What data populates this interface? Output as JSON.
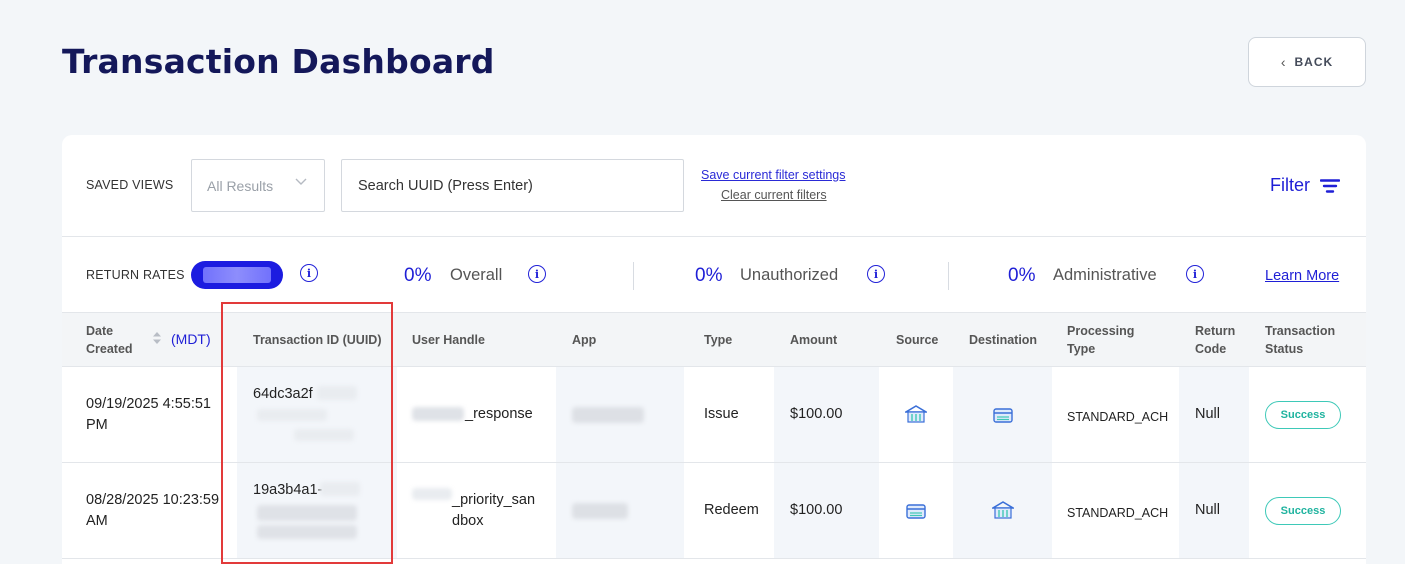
{
  "page": {
    "title": "Transaction Dashboard",
    "back_label": "BACK"
  },
  "filters": {
    "saved_views_label": "SAVED VIEWS",
    "saved_views_value": "All Results",
    "search_placeholder": "Search UUID (Press Enter)",
    "save_link": "Save current filter settings",
    "clear_link": "Clear current filters",
    "filter_label": "Filter"
  },
  "rates": {
    "label": "RETURN RATES",
    "items": [
      {
        "pct": "0%",
        "name": "Overall"
      },
      {
        "pct": "0%",
        "name": "Unauthorized"
      },
      {
        "pct": "0%",
        "name": "Administrative"
      }
    ],
    "learn_more": "Learn More"
  },
  "table": {
    "headers": {
      "date": "Date Created",
      "tz": "(MDT)",
      "txid": "Transaction ID (UUID)",
      "user": "User Handle",
      "app": "App",
      "type": "Type",
      "amount": "Amount",
      "source": "Source",
      "destination": "Destination",
      "processing": "Processing Type",
      "return_code": "Return Code",
      "status": "Transaction Status"
    },
    "rows": [
      {
        "date": "09/19/2025 4:55:51 PM",
        "txid": "64dc3a2f",
        "user": "_response",
        "type": "Issue",
        "amount": "$100.00",
        "source_icon": "bank-icon",
        "destination_icon": "card-icon",
        "processing": "STANDARD_ACH",
        "return_code": "Null",
        "status": "Success"
      },
      {
        "date": "08/28/2025 10:23:59 AM",
        "txid": "19a3b4a1-",
        "user": "_priority_san dbox",
        "type": "Redeem",
        "amount": "$100.00",
        "source_icon": "card-icon",
        "destination_icon": "bank-icon",
        "processing": "STANDARD_ACH",
        "return_code": "Null",
        "status": "Success"
      }
    ]
  },
  "colors": {
    "accent": "#1f1fd6",
    "title": "#14185a",
    "success": "#1fb39f",
    "highlight": "#e23a3a"
  }
}
